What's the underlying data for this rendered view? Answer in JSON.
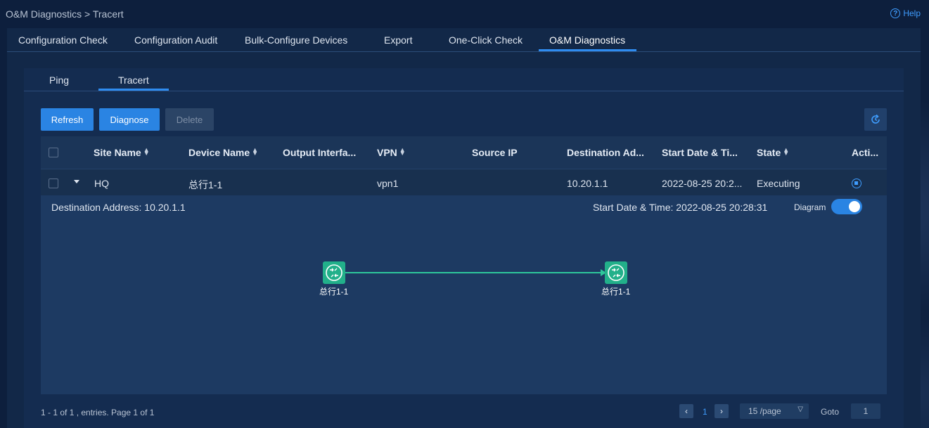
{
  "breadcrumb": "O&M Diagnostics > Tracert",
  "help": {
    "label": "Help",
    "icon": "help-circle-icon"
  },
  "main_tabs": [
    {
      "label": "Configuration Check"
    },
    {
      "label": "Configuration Audit"
    },
    {
      "label": "Bulk-Configure Devices"
    },
    {
      "label": "Export"
    },
    {
      "label": "One-Click Check"
    },
    {
      "label": "O&M Diagnostics",
      "active": true
    }
  ],
  "sub_tabs": [
    {
      "label": "Ping"
    },
    {
      "label": "Tracert",
      "active": true
    }
  ],
  "toolbar": {
    "refresh_label": "Refresh",
    "diagnose_label": "Diagnose",
    "delete_label": "Delete",
    "reload_icon": "reload-icon"
  },
  "table": {
    "columns": [
      {
        "label": "Site Name",
        "sortable": true
      },
      {
        "label": "Device Name",
        "sortable": true
      },
      {
        "label": "Output Interfa...",
        "sortable": false
      },
      {
        "label": "VPN",
        "sortable": true
      },
      {
        "label": "Source IP",
        "sortable": false
      },
      {
        "label": "Destination Ad...",
        "sortable": false
      },
      {
        "label": "Start Date & Ti...",
        "sortable": false
      },
      {
        "label": "State",
        "sortable": true
      },
      {
        "label": "Acti...",
        "sortable": false
      }
    ],
    "rows": [
      {
        "site_name": "HQ",
        "device_name": "总行1-1",
        "output_interface": "",
        "vpn": "vpn1",
        "source_ip": "",
        "destination": "10.20.1.1",
        "start_time": "2022-08-25 20:2...",
        "state": "Executing",
        "action_icon": "stop-icon"
      }
    ]
  },
  "detail": {
    "destination_text": "Destination Address: 10.20.1.1",
    "start_text": "Start Date & Time: 2022-08-25 20:28:31",
    "diagram_label": "Diagram",
    "diagram_on": true,
    "nodes": [
      {
        "label": "总行1-1",
        "icon": "router-icon"
      },
      {
        "label": "总行1-1",
        "icon": "router-icon"
      }
    ],
    "link_color": "#2ec79b"
  },
  "pagination": {
    "summary": "1 - 1 of 1 , entries. Page 1 of 1",
    "current_page": "1",
    "page_size": "15 /page",
    "goto_label": "Goto",
    "goto_value": "1"
  },
  "colors": {
    "accent": "#2a84e3",
    "background": "#0d1f3d",
    "node": "#22b08a"
  }
}
